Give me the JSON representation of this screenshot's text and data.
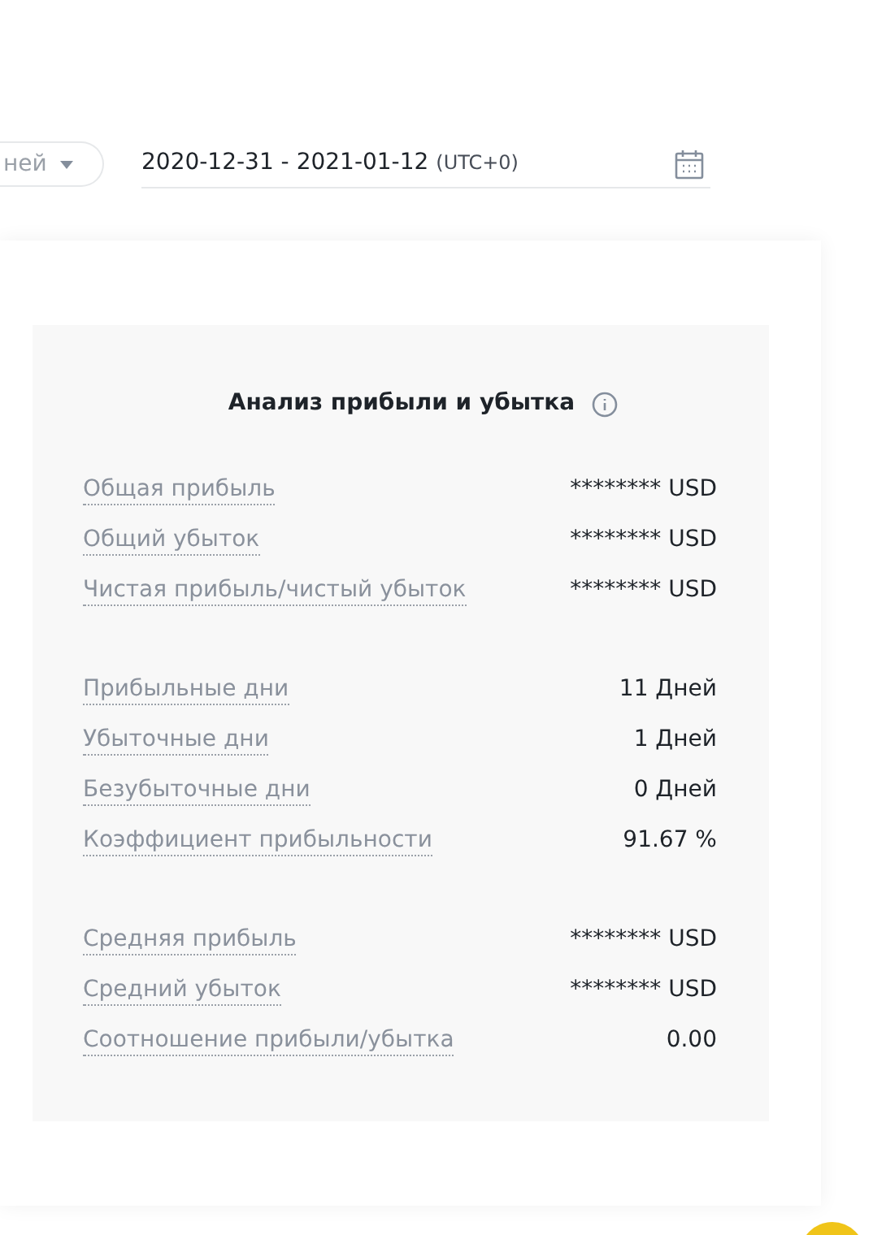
{
  "period_dropdown": {
    "label": "ней"
  },
  "date_range": {
    "value": "2020-12-31 - 2021-01-12",
    "timezone": "(UTC+0)"
  },
  "analysis": {
    "title": "Анализ прибыли и убытка",
    "groups": [
      [
        {
          "label": "Общая прибыль",
          "value": "******** USD"
        },
        {
          "label": "Общий убыток",
          "value": "******** USD"
        },
        {
          "label": "Чистая прибыль/чистый убыток",
          "value": "******** USD"
        }
      ],
      [
        {
          "label": "Прибыльные дни",
          "value": "11 Дней"
        },
        {
          "label": "Убыточные дни",
          "value": "1 Дней"
        },
        {
          "label": "Безубыточные дни",
          "value": "0 Дней"
        },
        {
          "label": "Коэффициент прибыльности",
          "value": "91.67 %"
        }
      ],
      [
        {
          "label": "Средняя прибыль",
          "value": "******** USD"
        },
        {
          "label": "Средний убыток",
          "value": "******** USD"
        },
        {
          "label": "Соотношение прибыли/убытка",
          "value": "0.00"
        }
      ]
    ]
  }
}
